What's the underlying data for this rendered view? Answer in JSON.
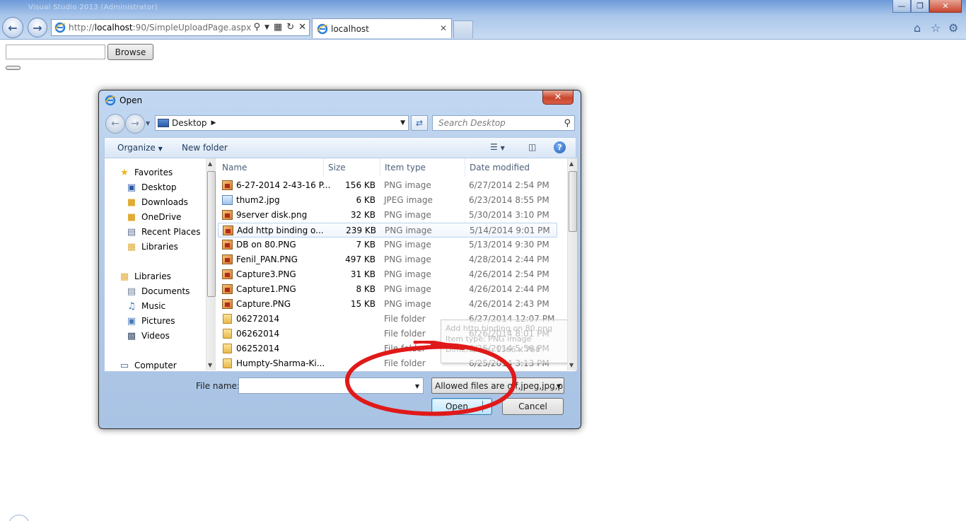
{
  "browser": {
    "address_url_prefix": "http://",
    "address_url_host": "localhost",
    "address_url_rest": ":90/SimpleUploadPage.aspx",
    "tab_title": "localhost",
    "titlebar_ghost": "Visual Studio 2013 (Administrator)"
  },
  "page": {
    "file_input_value": "",
    "browse_label": "Browse"
  },
  "dialog": {
    "title": "Open",
    "location": "Desktop",
    "search_placeholder": "Search Desktop",
    "toolbar": {
      "organize": "Organize",
      "new_folder": "New folder"
    },
    "nav": {
      "favorites_header": "Favorites",
      "favorites": [
        "Desktop",
        "Downloads",
        "OneDrive",
        "Recent Places",
        "Libraries"
      ],
      "libraries_header": "Libraries",
      "libraries": [
        "Documents",
        "Music",
        "Pictures",
        "Videos"
      ],
      "computer": "Computer"
    },
    "columns": {
      "name": "Name",
      "size": "Size",
      "type": "Item type",
      "date": "Date modified"
    },
    "files": [
      {
        "name": "6-27-2014 2-43-16 P...",
        "size": "156 KB",
        "type": "PNG image",
        "date": "6/27/2014 2:54 PM",
        "icon": "png"
      },
      {
        "name": "thum2.jpg",
        "size": "6 KB",
        "type": "JPEG image",
        "date": "6/23/2014 8:55 PM",
        "icon": "jpg"
      },
      {
        "name": "9server disk.png",
        "size": "32 KB",
        "type": "PNG image",
        "date": "5/30/2014 3:10 PM",
        "icon": "png"
      },
      {
        "name": "Add http binding o...",
        "size": "239 KB",
        "type": "PNG image",
        "date": "5/14/2014 9:01 PM",
        "icon": "png"
      },
      {
        "name": "DB on 80.PNG",
        "size": "7 KB",
        "type": "PNG image",
        "date": "5/13/2014 9:30 PM",
        "icon": "png"
      },
      {
        "name": "Fenil_PAN.PNG",
        "size": "497 KB",
        "type": "PNG image",
        "date": "4/28/2014 2:44 PM",
        "icon": "png"
      },
      {
        "name": "Capture3.PNG",
        "size": "31 KB",
        "type": "PNG image",
        "date": "4/26/2014 2:54 PM",
        "icon": "png"
      },
      {
        "name": "Capture1.PNG",
        "size": "8 KB",
        "type": "PNG image",
        "date": "4/26/2014 2:44 PM",
        "icon": "png"
      },
      {
        "name": "Capture.PNG",
        "size": "15 KB",
        "type": "PNG image",
        "date": "4/26/2014 2:43 PM",
        "icon": "png"
      },
      {
        "name": "06272014",
        "size": "",
        "type": "File folder",
        "date": "6/27/2014 12:07 PM",
        "icon": "folder"
      },
      {
        "name": "06262014",
        "size": "",
        "type": "File folder",
        "date": "6/26/2014 8:01 PM",
        "icon": "folder"
      },
      {
        "name": "06252014",
        "size": "",
        "type": "File folder",
        "date": "6/25/2014 5:56 PM",
        "icon": "folder"
      },
      {
        "name": "Humpty-Sharma-Ki...",
        "size": "",
        "type": "File folder",
        "date": "6/25/2014 3:13 PM",
        "icon": "folder"
      }
    ],
    "tooltip_lines": [
      "Add http binding on 80.png",
      "Item type: PNG image",
      "Dimensions: 1366 x 768",
      "Size: 239 KB"
    ],
    "filename_label": "File name:",
    "filename_value": "",
    "filter_label": "Allowed files are gif,jpeg,jpg,pr",
    "open_label": "Open",
    "cancel_label": "Cancel"
  },
  "colors": {
    "annotation": "#e01919",
    "chrome": "#a9c6ea",
    "accent": "#3c7fb1"
  }
}
